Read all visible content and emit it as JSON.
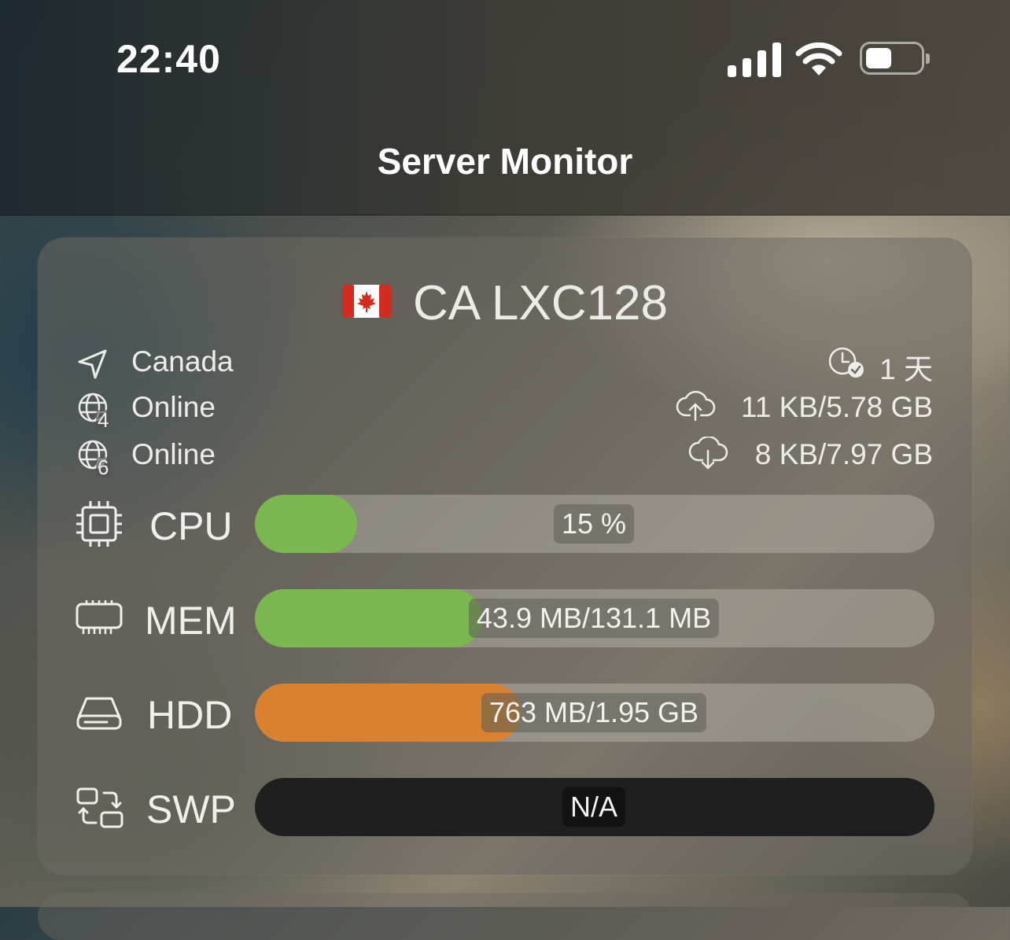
{
  "status_bar": {
    "time": "22:40"
  },
  "nav": {
    "title": "Server Monitor"
  },
  "server": {
    "flag": "🇨🇦",
    "name": "CA LXC128",
    "location": "Canada",
    "ipv4_status": "Online",
    "ipv4_badge": "4",
    "ipv6_status": "Online",
    "ipv6_badge": "6",
    "uptime": "1 天",
    "upload": "11 KB/5.78 GB",
    "download": "8 KB/7.97 GB",
    "icons": {
      "location": "location-arrow-icon",
      "ipv4": "globe-icon",
      "ipv6": "globe-icon",
      "uptime": "clock-check-icon",
      "upload": "cloud-upload-icon",
      "download": "cloud-download-icon"
    }
  },
  "metrics": [
    {
      "label": "CPU",
      "value_text": "15 %",
      "fraction": 0.15,
      "color": "#7ab84f",
      "icon": "cpu-icon"
    },
    {
      "label": "MEM",
      "value_text": "43.9 MB/131.1 MB",
      "fraction": 0.335,
      "color": "#7ab84f",
      "icon": "memory-icon"
    },
    {
      "label": "HDD",
      "value_text": "763 MB/1.95 GB",
      "fraction": 0.391,
      "color": "#d9812e",
      "icon": "disk-icon"
    },
    {
      "label": "SWP",
      "value_text": "N/A",
      "fraction": 0,
      "color": "#1a1a1a",
      "icon": "swap-icon"
    }
  ]
}
